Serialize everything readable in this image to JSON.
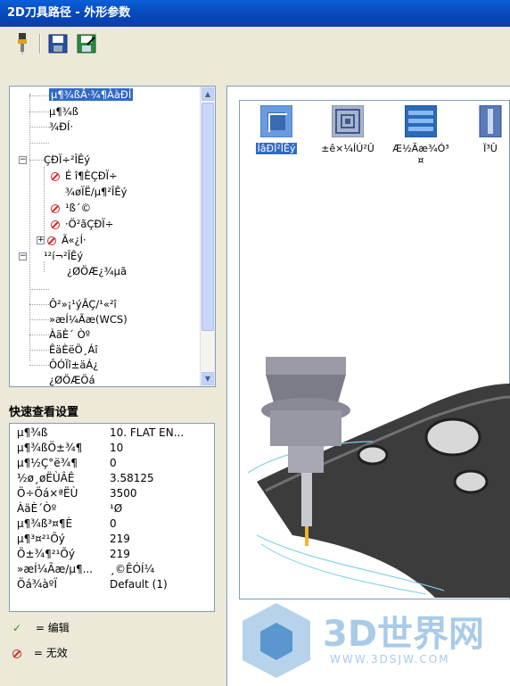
{
  "window": {
    "title": "2D刀具路径 - 外形参数"
  },
  "toolbar": {
    "icons": [
      "tool-icon",
      "save-icon",
      "save-as-icon"
    ]
  },
  "tree": {
    "items": [
      {
        "label": "µ¶¾ßÂ·¾¶ÀàÐÍ"
      },
      {
        "label": "µ¶¾ß"
      },
      {
        "label": "¾ÐÍ·"
      },
      {
        "label": "ÇÐÏ÷²ÎÊý"
      },
      {
        "label": "É î¶ÈÇÐÏ÷"
      },
      {
        "label": "¾øÏË/µ¶²ÎÊý"
      },
      {
        "label": "¹ß´©"
      },
      {
        "label": "·Ö²ãÇÐÏ÷"
      },
      {
        "label": "Ã«¿Í·"
      },
      {
        "label": "¹²í¬²ÎÊý"
      },
      {
        "label": "¿ØÖÆ¿¾µã"
      },
      {
        "label": "Ô²»¡¹ýÂÇ/¹«²î"
      },
      {
        "label": "»æÍ¼Ãæ(WCS)"
      },
      {
        "label": "ÀäÈ´ Òº"
      },
      {
        "label": "ÊäÈëÖ¸Áî"
      },
      {
        "label": "ÔÓÏî±äÁ¿"
      },
      {
        "label": "¿ØÖÆÖá"
      }
    ]
  },
  "quick_settings": {
    "title": "快速查看设置",
    "rows": [
      {
        "key": "µ¶¾ß",
        "value": "10. FLAT EN..."
      },
      {
        "key": "µ¶¾ßÖ±¾¶",
        "value": "10"
      },
      {
        "key": "µ¶½Ç°ë¾¶",
        "value": "0"
      },
      {
        "key": "½ø¸øËÙÂÊ",
        "value": "3.58125"
      },
      {
        "key": "Ö÷Öá×ªËÙ",
        "value": "3500"
      },
      {
        "key": "ÀäÈ´Òº",
        "value": "¹Ø"
      },
      {
        "key": "µ¶¾ß³¤¶È",
        "value": "0"
      },
      {
        "key": "µ¶³¤²¹Õý",
        "value": "219"
      },
      {
        "key": "Ö±¾¶²¹Õý",
        "value": "219"
      },
      {
        "key": "»æÍ¼Ãæ/µ¶...",
        "value": "¸©ÊÓÍ¼"
      },
      {
        "key": "Öá¾àºÏ",
        "value": "Default (1)"
      }
    ]
  },
  "legend": {
    "edit": "= 编辑",
    "invalid": "= 无效"
  },
  "operations": [
    {
      "label": "ÍâÐÎ²ÎÊý",
      "icon": "contour-icon"
    },
    {
      "label": "±ê×¼ÍÚ²Û",
      "icon": "pocket-icon"
    },
    {
      "label": "Æ½Ãæ¾Ó³",
      "sub": "¤",
      "icon": "facing-icon"
    },
    {
      "label": "Ï³Û",
      "icon": "slot-icon"
    }
  ],
  "watermark": {
    "brand": "3D世界网",
    "url": "WWW.3DSJW.COM"
  },
  "colors": {
    "title_bar": "#0846b8",
    "selection": "#316ac5",
    "invalid": "#d42a2a",
    "edit": "#2f8f2f"
  }
}
